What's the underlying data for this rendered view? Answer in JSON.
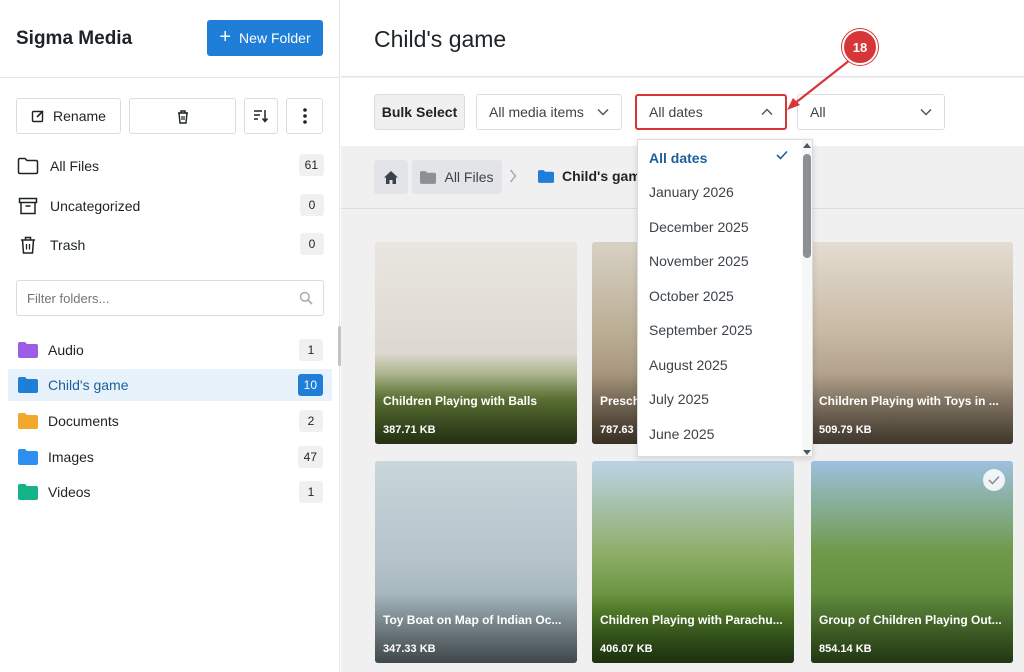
{
  "sidebar": {
    "brand": "Sigma Media",
    "new_folder_label": "New Folder",
    "toolbar": {
      "rename_label": "Rename"
    },
    "nav": [
      {
        "label": "All Files",
        "count": "61",
        "icon": "folder-outline-icon"
      },
      {
        "label": "Uncategorized",
        "count": "0",
        "icon": "archive-icon"
      },
      {
        "label": "Trash",
        "count": "0",
        "icon": "trash-icon"
      }
    ],
    "filter_placeholder": "Filter folders...",
    "folders": [
      {
        "label": "Audio",
        "count": "1",
        "color": "#9b5de5"
      },
      {
        "label": "Child's game",
        "count": "10",
        "color": "#1e7ed8",
        "active": true
      },
      {
        "label": "Documents",
        "count": "2",
        "color": "#f0a92b"
      },
      {
        "label": "Images",
        "count": "47",
        "color": "#2f8ff0"
      },
      {
        "label": "Videos",
        "count": "1",
        "color": "#15b38a"
      }
    ]
  },
  "main": {
    "title": "Child's game",
    "bulk_select_label": "Bulk Select",
    "media_filter": "All media items",
    "date_filter": "All dates",
    "third_filter": "All",
    "breadcrumb": {
      "all_files": "All Files",
      "current": "Child's game"
    }
  },
  "date_dropdown": {
    "options": [
      "All dates",
      "January 2026",
      "December 2025",
      "November 2025",
      "October 2025",
      "September 2025",
      "August 2025",
      "July 2025",
      "June 2025"
    ],
    "selected": "All dates"
  },
  "cards": [
    {
      "caption": "Children Playing with Balls",
      "size": "387.71 KB"
    },
    {
      "caption": "Preschool",
      "size": "787.63 KB"
    },
    {
      "caption": "Children Playing with Toys in ...",
      "size": "509.79 KB"
    },
    {
      "caption": "Toy Boat on Map of Indian Oc...",
      "size": "347.33 KB"
    },
    {
      "caption": "Children Playing with Parachu...",
      "size": "406.07 KB"
    },
    {
      "caption": "Group of Children Playing Out...",
      "size": "854.14 KB"
    }
  ],
  "annotation": {
    "step": "18",
    "color": "#d63638"
  }
}
